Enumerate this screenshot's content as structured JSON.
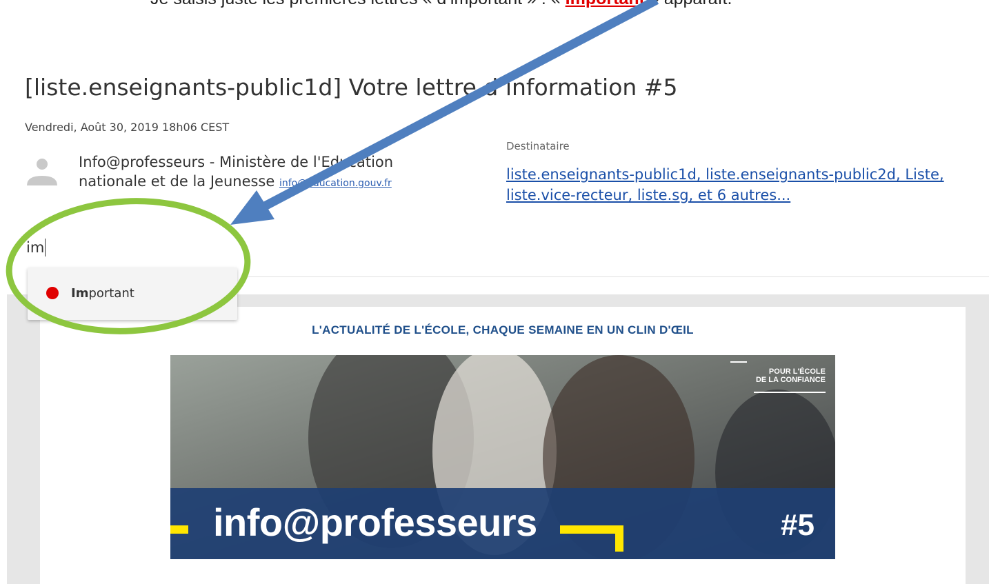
{
  "instruction": {
    "before": "Je saisis juste les premières lettres « d’important » : « ",
    "highlight": "Important",
    "after": " » apparaît."
  },
  "message": {
    "subject": "[liste.enseignants-public1d] Votre lettre d’information #5",
    "date": "Vendredi, Août 30, 2019 18h06 CEST",
    "sender_name": "Info@professeurs - Ministère de l'Education nationale et de la Jeunesse",
    "sender_email": "info@education.gouv.fr",
    "recipients_label": "Destinataire",
    "recipients": "liste.enseignants-public1d, liste.enseignants-public2d, Liste, liste.vice-recteur, liste.sg, et 6 autres..."
  },
  "tag_search": {
    "value": "im",
    "suggestion_bold": "Im",
    "suggestion_rest": "portant",
    "suggestion_color": "#e00000"
  },
  "newsletter": {
    "tagline": "L'ACTUALITÉ DE L'ÉCOLE, CHAQUE SEMAINE EN UN CLIN D'ŒIL",
    "banner_title": "info@professeurs",
    "banner_number": "#5",
    "badge_line1": "POUR L'ÉCOLE",
    "badge_line2": "DE LA CONFIANCE"
  },
  "colors": {
    "ring": "#8dc63f",
    "arrow": "#4f7fbf",
    "banner_blue": "#1e3f73",
    "banner_yellow": "#ffe600"
  }
}
